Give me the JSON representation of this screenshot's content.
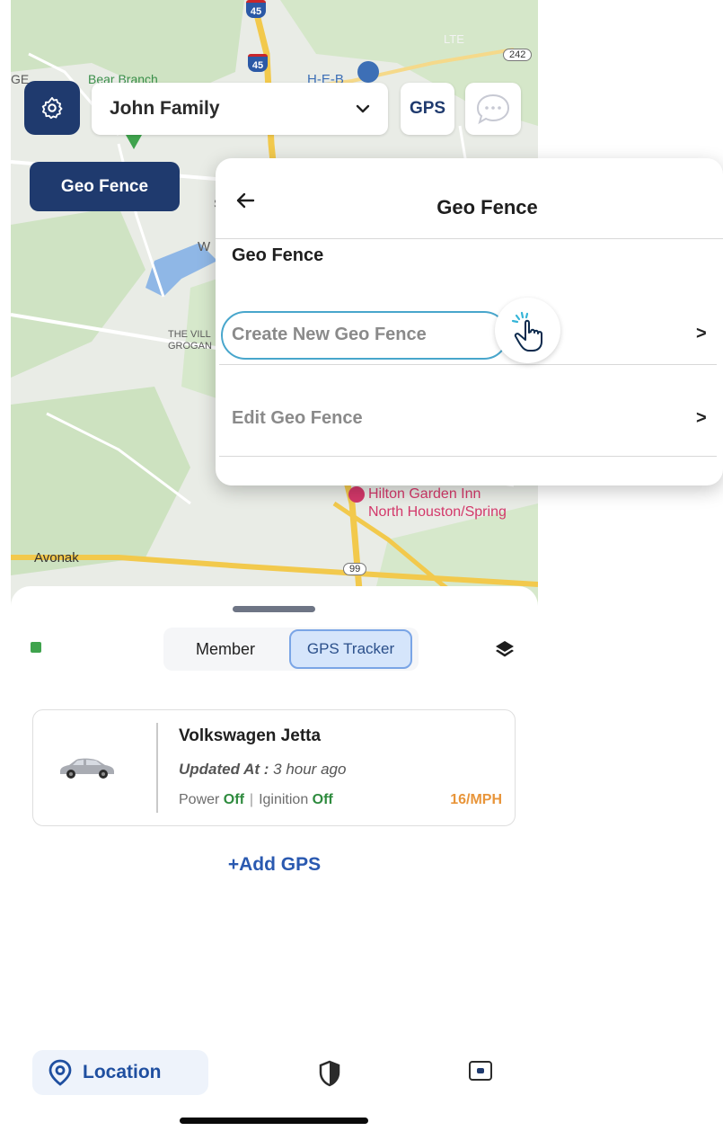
{
  "map": {
    "labels": {
      "bear_branch": "Bear Branch",
      "heb": "H-E-B",
      "lte": "LTE",
      "ge": "GE",
      "woodlands_frag": "W",
      "village": "THE VILL\nGROGAN",
      "hilton": "Hilton Garden Inn\nNorth Houston/Spring",
      "avonak": "Avonak",
      "s_frag": "S"
    },
    "badges": {
      "hwy_45_top": "45",
      "hwy_45": "45",
      "road_242": "242",
      "road_99": "99"
    }
  },
  "topbar": {
    "settings_icon": "gear-icon",
    "family_name": "John Family",
    "dropdown_icon": "chevron-down-icon",
    "gps_label": "GPS",
    "chat_icon": "chat-bubble-icon"
  },
  "geo_chip": {
    "label": "Geo Fence"
  },
  "popup": {
    "title": "Geo Fence",
    "section_title": "Geo Fence",
    "rows": [
      {
        "label": "Create New Geo Fence"
      },
      {
        "label": "Edit Geo Fence"
      }
    ],
    "chevron": ">"
  },
  "sheet": {
    "segments": {
      "member": "Member",
      "gps_tracker": "GPS Tracker",
      "selected": "GPS Tracker"
    },
    "vehicle": {
      "name": "Volkswagen  Jetta",
      "updated_label": "Updated At :",
      "updated_value": " 3 hour ago",
      "power_label": "Power ",
      "power_value": "Off",
      "ignition_label": "Iginition ",
      "ignition_value": "Off",
      "separator": "|",
      "speed": "16/MPH"
    },
    "add_gps": "+Add GPS"
  },
  "nav": {
    "location_label": "Location"
  },
  "colors": {
    "brand_navy": "#1f3a6e",
    "accent_blue": "#2a59b0",
    "speed_orange": "#e8953a",
    "status_green": "#2e8b3e"
  }
}
